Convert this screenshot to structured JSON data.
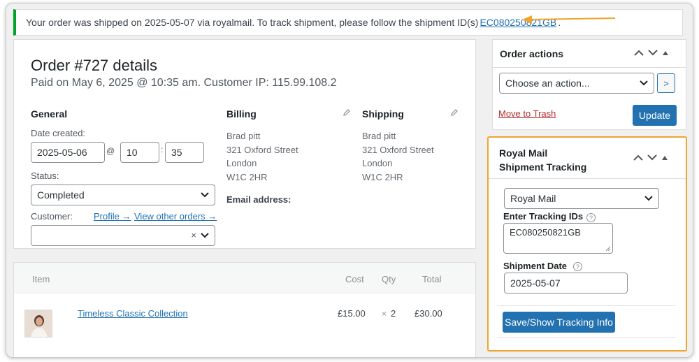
{
  "notice": {
    "text_before": "Your order was shipped on 2025-05-07 via royalmail. To track shipment, please follow the shipment ID(s)",
    "tracking_link": "EC080250821GB",
    "text_after": ".",
    "accent_color": "#00a32a",
    "annotation_color": "#f0a52c"
  },
  "order": {
    "title": "Order #727 details",
    "subtitle": "Paid on May 6, 2025 @ 10:35 am. Customer IP: 115.99.108.2",
    "general": {
      "heading": "General",
      "date_label": "Date created:",
      "date_value": "2025-05-06",
      "at_sep": "@",
      "hour": "10",
      "colon": ":",
      "minute": "35",
      "status_label": "Status:",
      "status_value": "Completed",
      "customer_label": "Customer:",
      "profile_link": "Profile →",
      "other_orders_link": "View other orders →",
      "customer_clear": "×"
    },
    "billing": {
      "heading": "Billing",
      "lines": [
        "Brad pitt",
        "321 Oxford Street",
        "London",
        "W1C 2HR"
      ],
      "email_label": "Email address:"
    },
    "shipping": {
      "heading": "Shipping",
      "lines": [
        "Brad pitt",
        "321 Oxford Street",
        "London",
        "W1C 2HR"
      ]
    }
  },
  "items": {
    "headers": {
      "item": "Item",
      "cost": "Cost",
      "qty": "Qty",
      "total": "Total"
    },
    "rows": [
      {
        "name": "Timeless Classic Collection",
        "cost": "£15.00",
        "qty_x": "×",
        "qty": "2",
        "total": "£30.00"
      }
    ]
  },
  "order_actions": {
    "title": "Order actions",
    "select_value": "Choose an action...",
    "go_label": ">",
    "trash_label": "Move to Trash",
    "update_label": "Update"
  },
  "royal_mail": {
    "title_line1": "Royal Mail",
    "title_line2": "Shipment Tracking",
    "provider_value": "Royal Mail",
    "tracking_label": "Enter Tracking IDs",
    "tracking_value": "EC080250821GB",
    "date_label": "Shipment Date",
    "date_value": "2025-05-07",
    "help_glyph": "?",
    "button_label": "Save/Show Tracking Info"
  },
  "icons": [
    "arrow-left-annotation-icon",
    "pencil-icon",
    "chevron-down-icon",
    "chevron-up-icon",
    "triangle-up-icon",
    "help-icon",
    "resize-handle-icon"
  ]
}
